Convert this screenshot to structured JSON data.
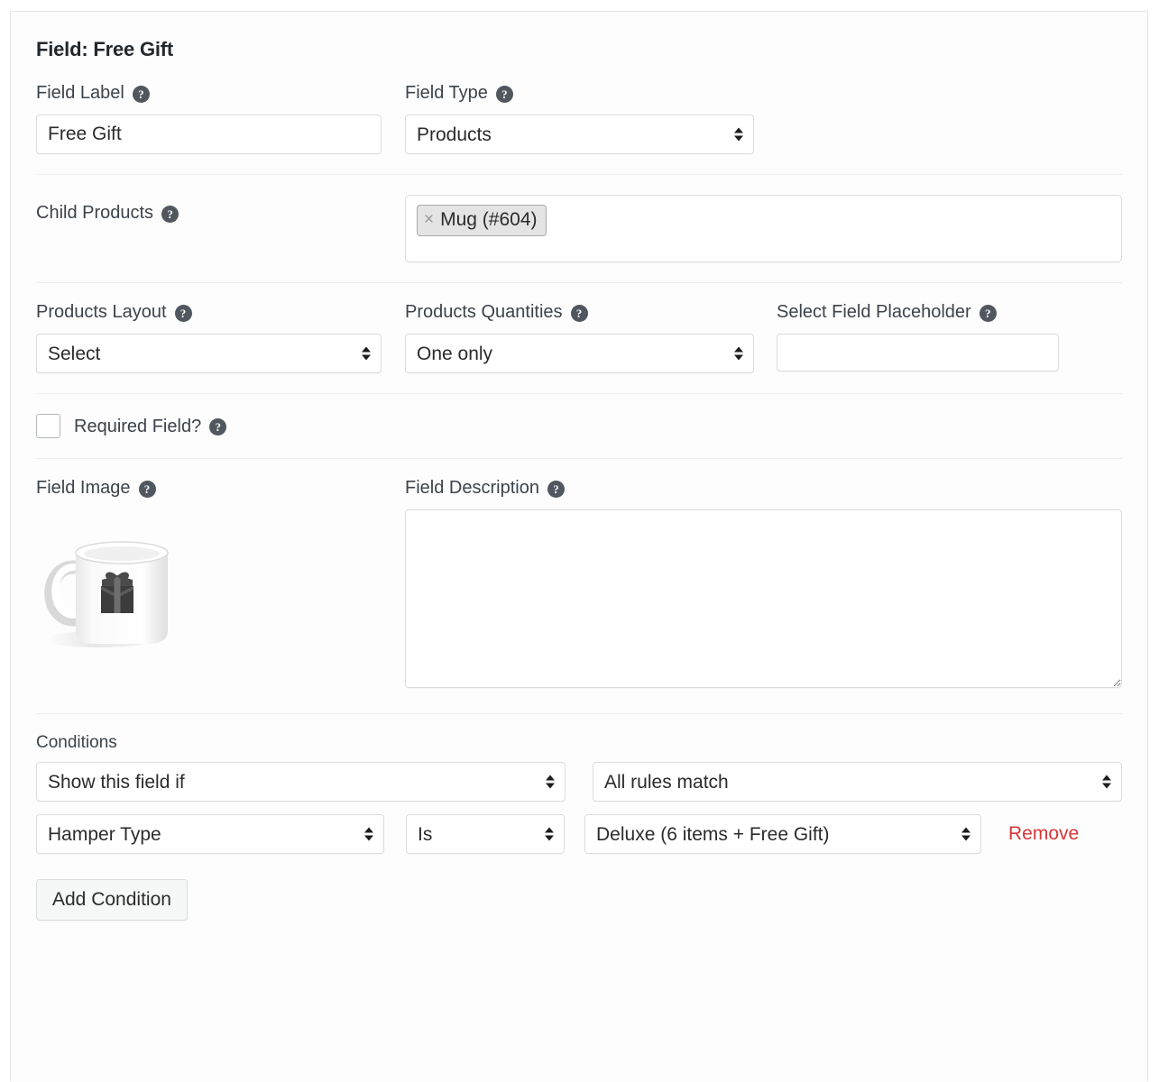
{
  "panel": {
    "title": "Field: Free Gift"
  },
  "help_icon": "?",
  "field_label": {
    "label": "Field Label",
    "value": "Free Gift",
    "placeholder": ""
  },
  "field_type": {
    "label": "Field Type",
    "value": "Products",
    "options": [
      "Products"
    ]
  },
  "child_products": {
    "label": "Child Products",
    "tokens": [
      {
        "remove_icon": "×",
        "text": "Mug (#604)"
      }
    ]
  },
  "products_layout": {
    "label": "Products Layout",
    "value": "Select",
    "options": [
      "Select"
    ]
  },
  "products_quantities": {
    "label": "Products Quantities",
    "value": "One only",
    "options": [
      "One only"
    ]
  },
  "select_field_placeholder": {
    "label": "Select Field Placeholder",
    "value": "",
    "placeholder": ""
  },
  "required_field": {
    "label": "Required Field?",
    "checked": false
  },
  "field_image": {
    "label": "Field Image",
    "image_alt": "mug-with-gift-box-image"
  },
  "field_description": {
    "label": "Field Description",
    "value": "",
    "placeholder": ""
  },
  "conditions": {
    "title": "Conditions",
    "visibility": {
      "value": "Show this field if",
      "options": [
        "Show this field if"
      ]
    },
    "match": {
      "value": "All rules match",
      "options": [
        "All rules match"
      ]
    },
    "rules": [
      {
        "field": "Hamper Type",
        "operator": "Is",
        "value": "Deluxe (6 items + Free Gift)",
        "remove_label": "Remove"
      }
    ],
    "add_label": "Add Condition"
  },
  "colors": {
    "accent_remove": "#d63638",
    "help_bg": "#50575e",
    "border": "#dcdcdc",
    "token_bg": "#e4e4e4"
  }
}
